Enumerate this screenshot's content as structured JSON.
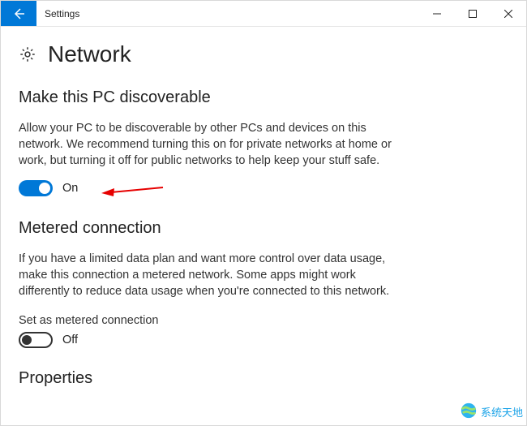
{
  "window": {
    "title": "Settings"
  },
  "page": {
    "title": "Network"
  },
  "sections": {
    "discoverable": {
      "title": "Make this PC discoverable",
      "body": "Allow your PC to be discoverable by other PCs and devices on this network. We recommend turning this on for private networks at home or work, but turning it off for public networks to help keep your stuff safe.",
      "toggle_state": "On"
    },
    "metered": {
      "title": "Metered connection",
      "body": "If you have a limited data plan and want more control over data usage, make this connection a metered network. Some apps might work differently to reduce data usage when you're connected to this network.",
      "label": "Set as metered connection",
      "toggle_state": "Off"
    },
    "properties": {
      "title": "Properties"
    }
  },
  "watermark": {
    "text": "系统天地"
  }
}
